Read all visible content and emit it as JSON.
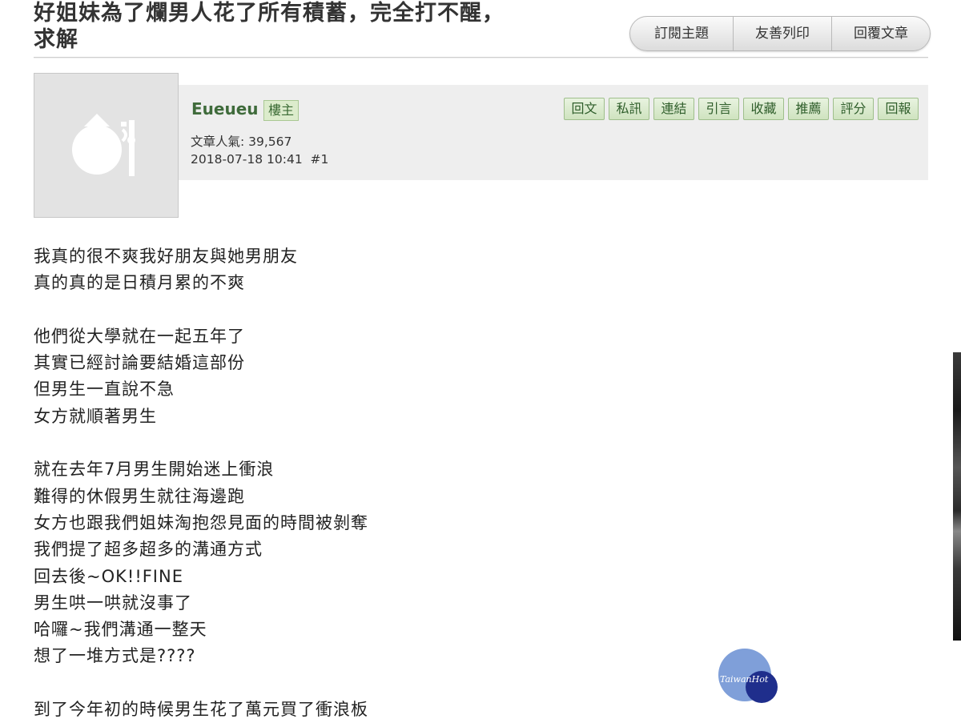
{
  "thread": {
    "title_lines": [
      "好姐妹為了爛男人花了所有積蓄，完全打不醒，",
      "求解"
    ]
  },
  "top_actions": {
    "subscribe": "訂閱主題",
    "print": "友善列印",
    "reply_post": "回覆文章"
  },
  "author": {
    "name": "Eueueu",
    "badge": "樓主",
    "popularity": "文章人氣: 39,567",
    "timestamp": "2018-07-18 10:41",
    "floor": "#1"
  },
  "post_actions": [
    "回文",
    "私訊",
    "連結",
    "引言",
    "收藏",
    "推薦",
    "評分",
    "回報"
  ],
  "body_lines": [
    "我真的很不爽我好朋友與她男朋友",
    "真的真的是日積月累的不爽",
    "",
    "他們從大學就在一起五年了",
    "其實已經討論要結婚這部份",
    "但男生一直說不急",
    "女方就順著男生",
    "",
    "就在去年7月男生開始迷上衝浪",
    "難得的休假男生就往海邊跑",
    "女方也跟我們姐妹淘抱怨見面的時間被剝奪",
    "我們提了超多超多的溝通方式",
    "回去後~OK!!FINE",
    "男生哄一哄就沒事了",
    "哈囉~我們溝通一整天",
    "想了一堆方式是????",
    "",
    "到了今年初的時候男生花了萬元買了衝浪板"
  ],
  "watermark": {
    "text": "TaiwanHot",
    "colors": {
      "light": "#7f9fd9",
      "dark": "#1f2e8c"
    }
  },
  "colors": {
    "author_green": "#3f6b3b",
    "badge_bg": "#dceccc",
    "bar_bg": "#eeeeee"
  }
}
